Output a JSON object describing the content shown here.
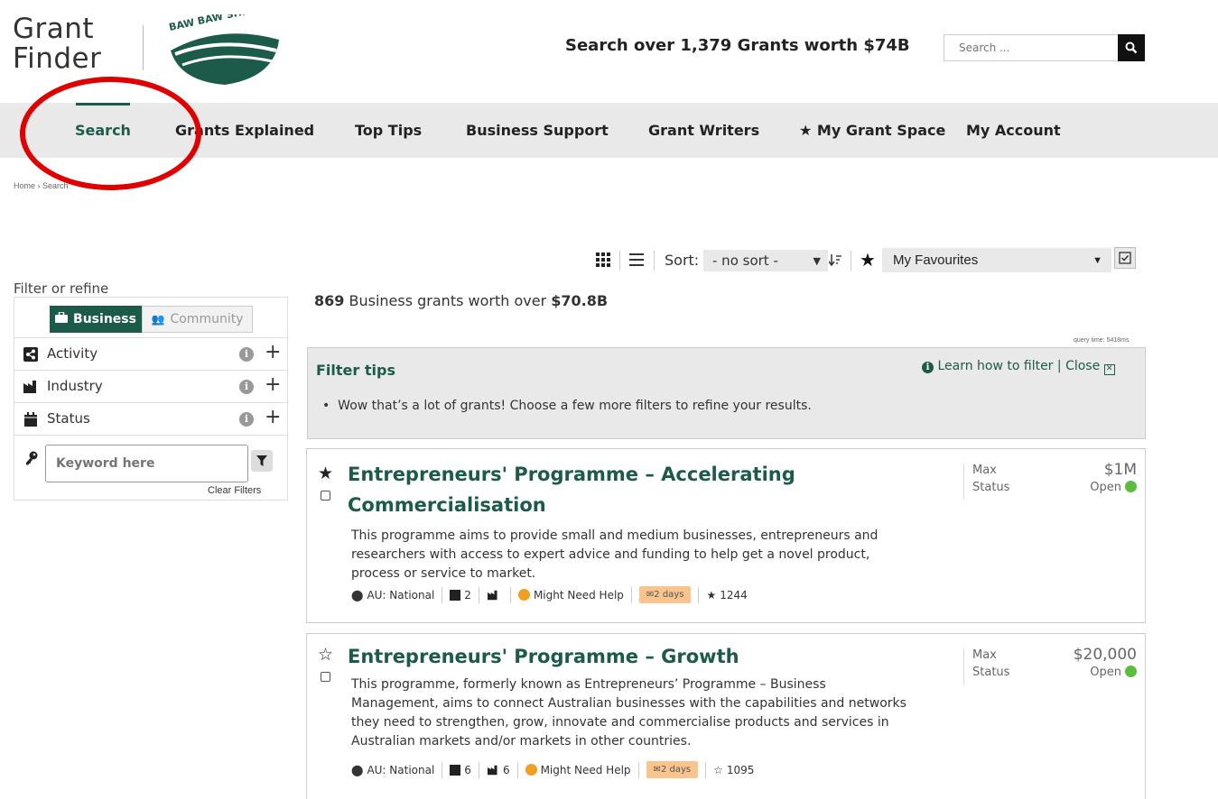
{
  "header": {
    "logo_line1": "Grant",
    "logo_line2": "Finder",
    "council_text": "BAW BAW SHIRE COUNCIL",
    "tagline": "Search over 1,379 Grants worth $74B",
    "search_placeholder": "Search ..."
  },
  "nav": {
    "items": [
      {
        "label": "Search",
        "active": true
      },
      {
        "label": "Grants Explained"
      },
      {
        "label": "Top Tips"
      },
      {
        "label": "Business Support"
      },
      {
        "label": "Grant Writers"
      },
      {
        "label": "My Grant Space",
        "icon": "star-icon"
      },
      {
        "label": "My Account"
      }
    ]
  },
  "breadcrumb": {
    "home": "Home",
    "current": "Search"
  },
  "toolbar": {
    "sort_label": "Sort:",
    "sort_value": "- no sort -",
    "favourites_value": "My Favourites"
  },
  "sidebar": {
    "title": "Filter or refine",
    "toggle": {
      "business": "Business",
      "community": "Community"
    },
    "facets": [
      {
        "label": "Activity",
        "icon": "share-icon"
      },
      {
        "label": "Industry",
        "icon": "industry-icon"
      },
      {
        "label": "Status",
        "icon": "calendar-icon"
      }
    ],
    "keyword_placeholder": "Keyword here",
    "clear_filters": "Clear Filters"
  },
  "results": {
    "count": "869",
    "count_text": " Business grants worth over ",
    "amount": "$70.8B",
    "query_time": "query time: 5418ms"
  },
  "tips": {
    "title": "Filter tips",
    "learn_link": "Learn how to filter",
    "divider": "|",
    "close_link": "Close",
    "bullet": "Wow that’s a lot of grants! Choose a few more filters to refine your results."
  },
  "grants": [
    {
      "title_line1": "Entrepreneurs' Programme – Accelerating",
      "title_line2": "Commercialisation",
      "desc_line1": "This programme aims to provide small and medium businesses, entrepreneurs and",
      "desc_line2": "researchers with access to expert advice and funding to help get a novel product,",
      "desc_line3": "process or service to market.",
      "location": "AU: National",
      "activity_count": "2",
      "industry_count": "",
      "help": "Might Need Help",
      "days": "2 days",
      "favourites": "1244",
      "favourited": true,
      "max_label": "Max",
      "max_value": "$1M",
      "status_label": "Status",
      "status_value": "Open"
    },
    {
      "title_line1": "Entrepreneurs' Programme – Growth",
      "desc_line1": "This programme, formerly known as Entrepreneurs’ Programme – Business",
      "desc_line2": "Management, aims to connect Australian businesses with the capabilities and networks",
      "desc_line3": "they need to strengthen, grow, innovate and commercialise products and services in",
      "desc_line4": "Australian markets and/or markets in other countries.",
      "location": "AU: National",
      "activity_count": "6",
      "industry_count": "6",
      "help": "Might Need Help",
      "days": "2 days",
      "favourites": "1095",
      "favourited": false,
      "max_label": "Max",
      "max_value": "$20,000",
      "status_label": "Status",
      "status_value": "Open"
    }
  ],
  "colors": {
    "brand_green": "#1c5b4a",
    "nav_bg": "#e9e9e9",
    "open_dot": "#5cbd3c",
    "badge": "#f9c48e",
    "annotation_ring": "#e00000"
  }
}
